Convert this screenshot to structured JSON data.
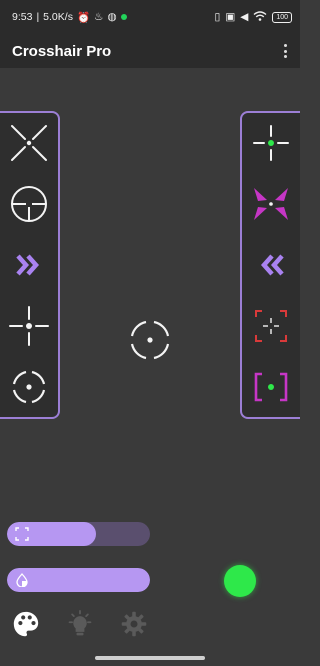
{
  "status_bar": {
    "time": "9:53",
    "speed": "5.0K/s",
    "battery": "100"
  },
  "app": {
    "title": "Crosshair Pro"
  },
  "left_panel": {
    "items": [
      "x-crosshair-icon",
      "scope-crosshair-icon",
      "chevron-double-right-icon",
      "plus-dot-crosshair-icon",
      "circle-dot-crosshair-icon"
    ]
  },
  "right_panel": {
    "items": [
      "green-dot-cross-crosshair-icon",
      "magenta-x-crosshair-icon",
      "chevron-double-left-icon",
      "red-bracket-crosshair-icon",
      "magenta-bracket-crosshair-icon"
    ]
  },
  "sliders": {
    "size_value": 0.62,
    "opacity_value": 1.0
  },
  "colors": {
    "accent": "#b697f2",
    "panel_border": "#9c7fd6",
    "green": "#2ee84a",
    "magenta": "#c636c6",
    "red": "#d93a3a"
  }
}
